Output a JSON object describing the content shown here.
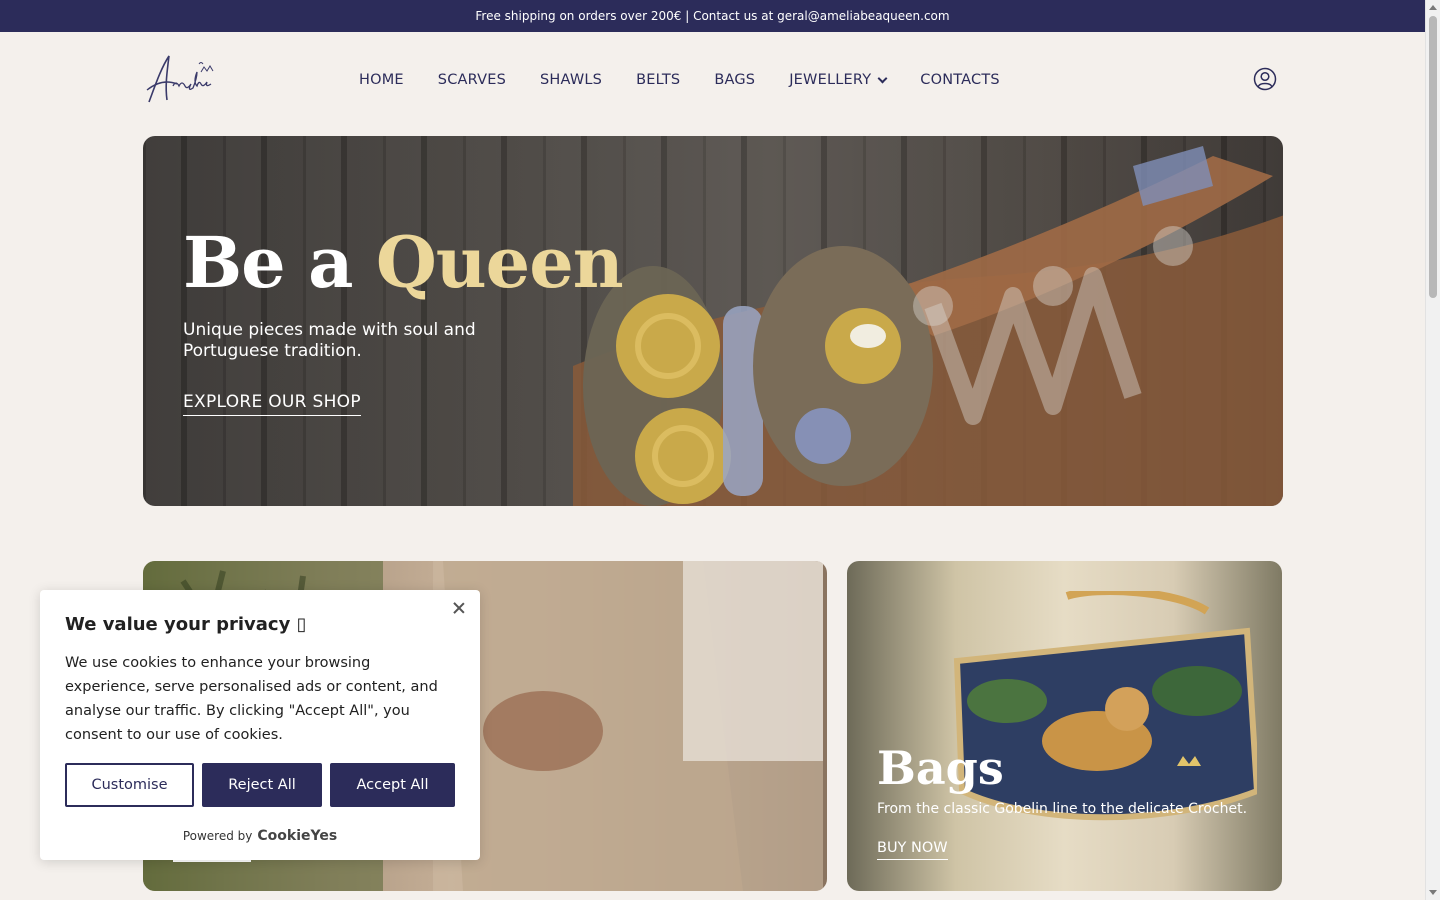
{
  "announcement": "Free shipping on orders over 200€ | Contact us at geral@ameliabeaqueen.com",
  "logo": {
    "text": "Amélia"
  },
  "nav": {
    "items": [
      {
        "label": "HOME"
      },
      {
        "label": "SCARVES"
      },
      {
        "label": "SHAWLS"
      },
      {
        "label": "BELTS"
      },
      {
        "label": "BAGS"
      },
      {
        "label": "JEWELLERY",
        "dropdown": true
      },
      {
        "label": "CONTACTS"
      }
    ],
    "account_icon": "user-circle-icon"
  },
  "hero": {
    "title_start": "Be a ",
    "title_accent": "Queen",
    "subtitle": "Unique pieces made with soul and Portuguese tradition.",
    "cta": "EXPLORE OUR SHOP",
    "accent_color": "#ecd79a"
  },
  "cards": {
    "bags": {
      "title": "Bags",
      "subtitle": "From the classic Gobelin line to the delicate Crochet.",
      "cta": "BUY NOW"
    }
  },
  "cookie": {
    "title": "We value your privacy ▯",
    "text": "We use cookies to enhance your browsing experience, serve personalised ads or content, and analyse our traffic. By clicking \"Accept All\", you consent to our use of cookies.",
    "buttons": {
      "customise": "Customise",
      "reject": "Reject All",
      "accept": "Accept All"
    },
    "powered_by": "Powered by",
    "powered_brand": "CookieYes"
  },
  "colors": {
    "brand": "#2c2c5a",
    "background": "#f4f0ec"
  }
}
